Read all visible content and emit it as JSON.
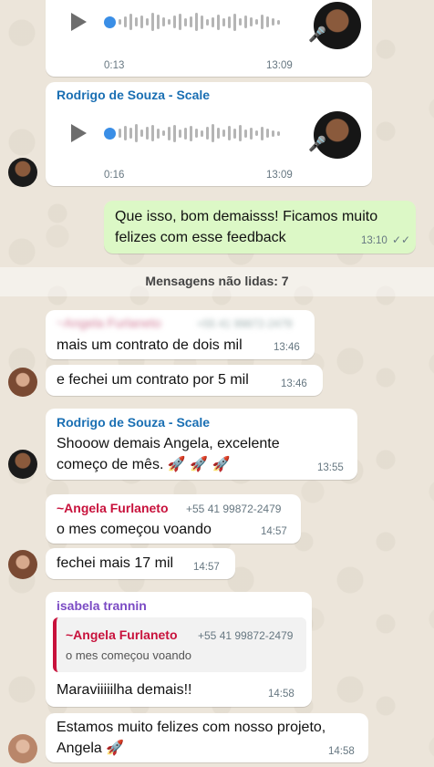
{
  "audio_1": {
    "duration": "0:13",
    "time": "13:09"
  },
  "audio_2": {
    "sender": "Rodrigo de Souza - Scale",
    "duration": "0:16",
    "time": "13:09"
  },
  "out_1": {
    "text_line1": "Que isso, bom demaisss! Ficamos muito",
    "text_line2": "felizes com esse feedback",
    "time": "13:10",
    "status": "read"
  },
  "unread": {
    "label": "Mensagens não lidas: 7"
  },
  "msg_1": {
    "sender": "~Angela Furlaneto",
    "phone": "+55 41 99872-2479",
    "text": "mais um contrato de dois mil",
    "time": "13:46"
  },
  "msg_2": {
    "text": "e fechei um contrato por 5 mil",
    "time": "13:46"
  },
  "msg_3": {
    "sender": "Rodrigo de Souza - Scale",
    "text_line1": "Shooow demais Angela, excelente",
    "text_line2": "começo de mês. 🚀 🚀 🚀",
    "time": "13:55"
  },
  "msg_4": {
    "sender": "~Angela Furlaneto",
    "phone": "+55 41 99872-2479",
    "text": "o mes começou voando",
    "time": "14:57"
  },
  "msg_5": {
    "text": "fechei mais 17 mil",
    "time": "14:57"
  },
  "msg_6": {
    "sender": "isabela trannin",
    "quote_sender": "~Angela Furlaneto",
    "quote_phone": "+55 41 99872-2479",
    "quote_text": "o mes começou voando",
    "text": "Maraviiiiilha demais!!",
    "time": "14:58"
  },
  "msg_7": {
    "text_line1": "Estamos muito felizes com nosso projeto,",
    "text_line2": "Angela 🚀",
    "time": "14:58"
  },
  "colors": {
    "rodrigo": "#1a6fb3",
    "angela": "#c8123c",
    "isabela": "#7b4bc4",
    "outgoing_bg": "#dcf8c6",
    "incoming_bg": "#ffffff"
  },
  "icons": [
    "play-icon",
    "mic-icon",
    "double-check-icon",
    "rocket-emoji"
  ]
}
